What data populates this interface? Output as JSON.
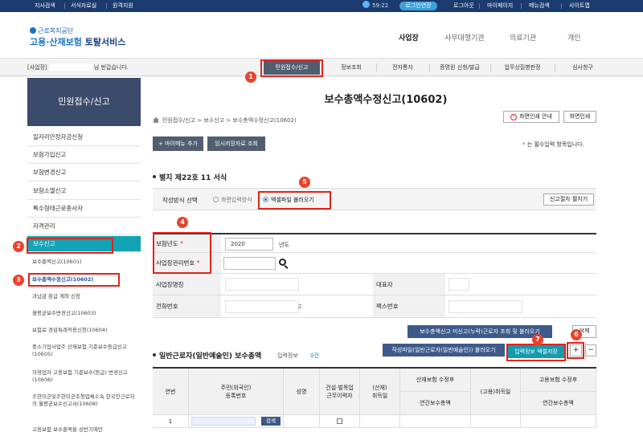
{
  "topbar": {
    "links": [
      "지사검색",
      "서식자료실",
      "원격지원"
    ],
    "timer": "59:22",
    "extend_label": "로그인연장",
    "right_links": [
      "로그아웃",
      "마이페이지",
      "메뉴검색",
      "사이트맵"
    ]
  },
  "header": {
    "logo_small": "근로복지공단",
    "logo_main_accent": "고용·산재보험",
    "logo_main_rest": " 토탈서비스",
    "gnb": [
      "사업장",
      "사무대행기관",
      "의료기관",
      "개인"
    ]
  },
  "menubar": {
    "welcome_prefix": "[사업장]",
    "welcome_suffix": "님 반갑습니다.",
    "items": [
      "민원접수/신고",
      "정보조회",
      "전자통지",
      "증명원 신청/발급",
      "업무상질병판정",
      "심사청구"
    ]
  },
  "sidebar": {
    "title": "민원접수/신고",
    "items": [
      "일자리안정자금신청",
      "보험가입신고",
      "보험변경신고",
      "보험소멸신고",
      "특수형태근로종사자",
      "자격관리",
      "보수신고"
    ],
    "sub_items": [
      "보수총액신고(10601)",
      "보수총액수정신고(10602)",
      "과납금 환급 계좌 신청",
      "월평균보수변경신고(10603)",
      "보험료 경감특례적용신청(10604)",
      "중소기업사업주 산재보험 기준보수등급신고(10605)",
      "자영업자 고용보험 기준보수(등급) 변경신고(10606)",
      "주한미군및주한미군초청업체소속 한국인근로자의 월평균보수신고서(10608)",
      "고용보험 보수총액을 상반기에만"
    ]
  },
  "markers": [
    "1",
    "2",
    "3",
    "4",
    "5",
    "6",
    "7"
  ],
  "main": {
    "title": "보수총액수정신고(10602)",
    "breadcrumb": "민원접수/신고 > 보수신고 > 보수총액수정신고(10602)",
    "print_guide": "화면인쇄 안내",
    "print": "화면인쇄",
    "add_menu": "+ 마이메뉴 추가",
    "temp_view": "임시저장자료 조회",
    "required_note": "는 필수입력 항목입니다.",
    "required_star": "*",
    "form_section": "별지 제22호 11 서식",
    "method_label": "작성방식 선택",
    "method_options": [
      "화면입력방식",
      "엑셀파일 불러오기"
    ],
    "procedure_toggle": "신고절차 펼치기",
    "fields": {
      "year_label": "보험년도",
      "year_value": "2020",
      "year_unit": "년도",
      "mgmt_label": "사업장관리번호",
      "name_label": "사업장명칭",
      "rep_label": "대표자",
      "phone_label": "전화번호",
      "fax_label": "팩스번호",
      "phone_tail": "2"
    },
    "btn_unreported": "보수총액신고 미신고(누락)근로자 조회 및 불러오기",
    "btn_delete": "삭제",
    "btn_load_file": "작성파일(일반근로자(일반예술인)) 불러오기",
    "btn_excel_save": "입력정보 엑셀저장",
    "btn_plus": "+",
    "btn_minus": "−",
    "grid_title": "일반근로자(일반예술인) 보수총액",
    "grid_info_label": "입력정보",
    "grid_info_count": "0건",
    "grid": {
      "headers": [
        "연번",
        "주민(외국인)\n등록번호",
        "성명",
        "건설·벌목업\n근무이력자",
        "(산재)\n취득일",
        "산재보험 수정후",
        "연간보수총액",
        "(고용)취득일",
        "고용보험 수정후",
        "연간보수총액"
      ],
      "row_no": "1",
      "search_btn": "검색"
    }
  }
}
